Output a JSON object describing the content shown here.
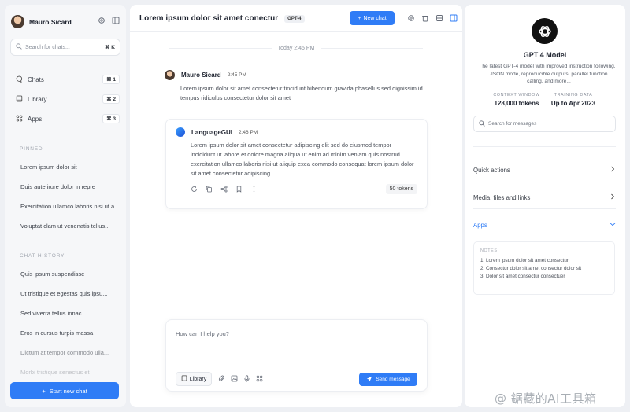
{
  "sidebar": {
    "user_name": "Mauro Sicard",
    "search_placeholder": "Search for chats...",
    "search_shortcut": "⌘ K",
    "nav": [
      {
        "label": "Chats",
        "shortcut": "⌘ 1",
        "icon": "chat-bubble-icon"
      },
      {
        "label": "Library",
        "shortcut": "⌘ 2",
        "icon": "book-icon"
      },
      {
        "label": "Apps",
        "shortcut": "⌘ 3",
        "icon": "apps-grid-icon"
      }
    ],
    "pinned_label": "PINNED",
    "pinned": [
      "Lorem ipsum dolor sit",
      "Duis aute irure dolor in repre",
      "Exercitation ullamco laboris nisi ut aliquip",
      "Voluptat clam ut venenatis tellus..."
    ],
    "history_label": "CHAT HISTORY",
    "history": [
      "Quis ipsum suspendisse",
      "Ut tristique et egestas quis ipsu...",
      "Sed viverra tellus innac",
      "Eros in cursus turpis massa",
      "Dictum at tempor commodo ulla...",
      "Morbi tristique senectus et"
    ],
    "new_chat_label": "Start new chat"
  },
  "header": {
    "title": "Lorem ipsum dolor sit amet conectur",
    "model_badge": "GPT-4",
    "new_chat_label": "New chat"
  },
  "conversation": {
    "date_label": "Today 2:45 PM",
    "user_message": {
      "name": "Mauro Sicard",
      "time": "2:45 PM",
      "text": "Lorem ipsum dolor sit amet consectetur tincidunt bibendum gravida phasellus sed dignissim id tempus ridiculus consectetur dolor sit amet"
    },
    "ai_message": {
      "name": "LanguageGUI",
      "time": "2:46 PM",
      "text": "Lorem ipsum dolor sit amet consectetur adipiscing elit sed do eiusmod tempor incididunt ut labore et dolore magna aliqua ut enim ad minim veniam quis nostrud exercitation ullamco laboris nisi ut aliquip exea commodo consequat lorem ipsum dolor sit amet consectetur adipiscing",
      "tokens": "50 tokens"
    }
  },
  "composer": {
    "placeholder": "How can I help you?",
    "library_label": "Library",
    "send_label": "Send message"
  },
  "model_panel": {
    "model_name": "GPT 4 Model",
    "description": "he latest GPT-4 model with improved instruction following, JSON mode, reproducible outputs, parallel function calling, and more...",
    "context_label": "CONTEXT WINDOW",
    "context_value": "128,000 tokens",
    "training_label": "TRAINING DATA",
    "training_value": "Up to Apr 2023",
    "search_placeholder": "Search for messages",
    "sections": [
      "Quick actions",
      "Media, files and links",
      "Apps"
    ],
    "notes_label": "NOTES",
    "notes": [
      "1. Lorem ipsum dolor sit amet consectur",
      "2. Consectur dolor sit amet consectur dolor sit",
      "3. Dolor sit amet consectur consectuer"
    ]
  },
  "watermark": "@ 鋸藏的AI工具箱",
  "colors": {
    "accent": "#2f7cf6",
    "background": "#eef0f4"
  }
}
